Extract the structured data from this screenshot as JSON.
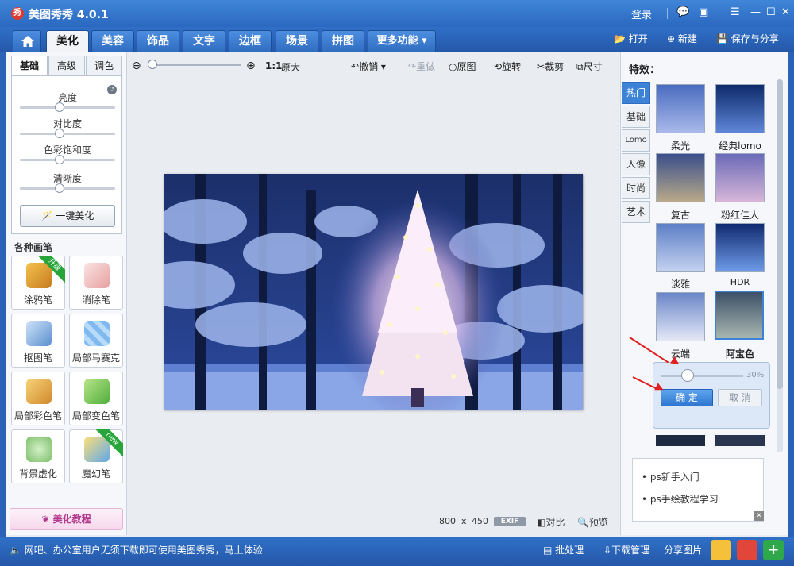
{
  "window": {
    "title": "美图秀秀 4.0.1",
    "login": "登录"
  },
  "main_tabs": [
    {
      "label": "美化",
      "active": true
    },
    {
      "label": "美容"
    },
    {
      "label": "饰品"
    },
    {
      "label": "文字"
    },
    {
      "label": "边框"
    },
    {
      "label": "场景"
    },
    {
      "label": "拼图"
    },
    {
      "label": "更多功能"
    }
  ],
  "top_actions": {
    "open": "打开",
    "new": "新建",
    "save_share": "保存与分享"
  },
  "left": {
    "subtabs": [
      "基础",
      "高级",
      "调色"
    ],
    "sliders": [
      {
        "label": "亮度",
        "value": 0.5
      },
      {
        "label": "对比度",
        "value": 0.5
      },
      {
        "label": "色彩饱和度",
        "value": 0.5
      },
      {
        "label": "清晰度",
        "value": 0.5
      }
    ],
    "oneclick": "一键美化",
    "brushes_title": "各种画笔",
    "tools": [
      {
        "label": "涂鸦笔",
        "badge": "升级"
      },
      {
        "label": "消除笔",
        "badge": ""
      },
      {
        "label": "抠图笔",
        "badge": ""
      },
      {
        "label": "局部马赛克",
        "badge": ""
      },
      {
        "label": "局部彩色笔",
        "badge": ""
      },
      {
        "label": "局部变色笔",
        "badge": ""
      },
      {
        "label": "背景虚化",
        "badge": ""
      },
      {
        "label": "魔幻笔",
        "badge": "new"
      }
    ],
    "tutorial": "美化教程"
  },
  "canvas_toolbar": {
    "ratio": "1:1",
    "original_size": "原大",
    "undo": "撤销",
    "redo": "重做",
    "original": "原图",
    "rotate": "旋转",
    "crop": "裁剪",
    "size": "尺寸"
  },
  "canvas_status": {
    "width": "800",
    "x": "x",
    "height": "450",
    "exif": "EXIF",
    "compare": "对比",
    "preview": "预览"
  },
  "effects": {
    "title": "特效：",
    "categories": [
      "热门",
      "基础",
      "Lomo",
      "人像",
      "时尚",
      "艺术"
    ],
    "items": [
      {
        "label": "柔光"
      },
      {
        "label": "经典lomo"
      },
      {
        "label": "复古"
      },
      {
        "label": "粉红佳人"
      },
      {
        "label": "淡雅"
      },
      {
        "label": "HDR"
      },
      {
        "label": "云端"
      },
      {
        "label": "阿宝色",
        "selected": true
      }
    ],
    "intensity": {
      "value_text": "30%",
      "value": 0.3
    },
    "ok": "确 定",
    "cancel": "取 消"
  },
  "ad": {
    "links": [
      "ps新手入门",
      "ps手绘教程学习"
    ]
  },
  "statusbar": {
    "message": "网吧、办公室用户无须下载即可使用美图秀秀，马上体验",
    "batch": "批处理",
    "download": "下载管理",
    "share": "分享图片"
  }
}
